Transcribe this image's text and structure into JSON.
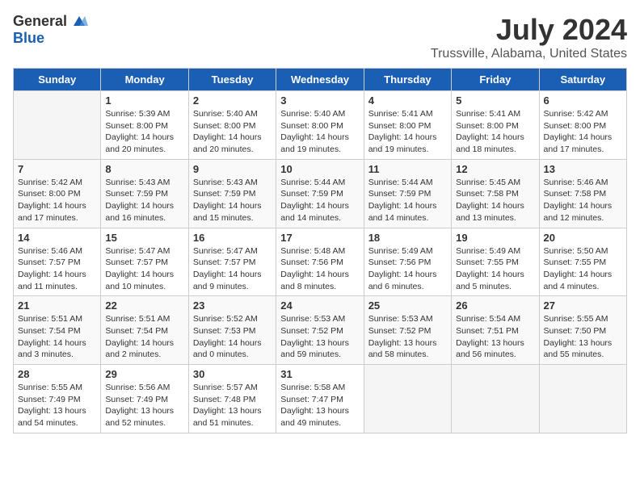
{
  "header": {
    "logo_general": "General",
    "logo_blue": "Blue",
    "title": "July 2024",
    "subtitle": "Trussville, Alabama, United States"
  },
  "columns": [
    "Sunday",
    "Monday",
    "Tuesday",
    "Wednesday",
    "Thursday",
    "Friday",
    "Saturday"
  ],
  "weeks": [
    [
      {
        "day": "",
        "empty": true
      },
      {
        "day": "1",
        "sunrise": "Sunrise: 5:39 AM",
        "sunset": "Sunset: 8:00 PM",
        "daylight": "Daylight: 14 hours and 20 minutes."
      },
      {
        "day": "2",
        "sunrise": "Sunrise: 5:40 AM",
        "sunset": "Sunset: 8:00 PM",
        "daylight": "Daylight: 14 hours and 20 minutes."
      },
      {
        "day": "3",
        "sunrise": "Sunrise: 5:40 AM",
        "sunset": "Sunset: 8:00 PM",
        "daylight": "Daylight: 14 hours and 19 minutes."
      },
      {
        "day": "4",
        "sunrise": "Sunrise: 5:41 AM",
        "sunset": "Sunset: 8:00 PM",
        "daylight": "Daylight: 14 hours and 19 minutes."
      },
      {
        "day": "5",
        "sunrise": "Sunrise: 5:41 AM",
        "sunset": "Sunset: 8:00 PM",
        "daylight": "Daylight: 14 hours and 18 minutes."
      },
      {
        "day": "6",
        "sunrise": "Sunrise: 5:42 AM",
        "sunset": "Sunset: 8:00 PM",
        "daylight": "Daylight: 14 hours and 17 minutes."
      }
    ],
    [
      {
        "day": "7",
        "sunrise": "Sunrise: 5:42 AM",
        "sunset": "Sunset: 8:00 PM",
        "daylight": "Daylight: 14 hours and 17 minutes."
      },
      {
        "day": "8",
        "sunrise": "Sunrise: 5:43 AM",
        "sunset": "Sunset: 7:59 PM",
        "daylight": "Daylight: 14 hours and 16 minutes."
      },
      {
        "day": "9",
        "sunrise": "Sunrise: 5:43 AM",
        "sunset": "Sunset: 7:59 PM",
        "daylight": "Daylight: 14 hours and 15 minutes."
      },
      {
        "day": "10",
        "sunrise": "Sunrise: 5:44 AM",
        "sunset": "Sunset: 7:59 PM",
        "daylight": "Daylight: 14 hours and 14 minutes."
      },
      {
        "day": "11",
        "sunrise": "Sunrise: 5:44 AM",
        "sunset": "Sunset: 7:59 PM",
        "daylight": "Daylight: 14 hours and 14 minutes."
      },
      {
        "day": "12",
        "sunrise": "Sunrise: 5:45 AM",
        "sunset": "Sunset: 7:58 PM",
        "daylight": "Daylight: 14 hours and 13 minutes."
      },
      {
        "day": "13",
        "sunrise": "Sunrise: 5:46 AM",
        "sunset": "Sunset: 7:58 PM",
        "daylight": "Daylight: 14 hours and 12 minutes."
      }
    ],
    [
      {
        "day": "14",
        "sunrise": "Sunrise: 5:46 AM",
        "sunset": "Sunset: 7:57 PM",
        "daylight": "Daylight: 14 hours and 11 minutes."
      },
      {
        "day": "15",
        "sunrise": "Sunrise: 5:47 AM",
        "sunset": "Sunset: 7:57 PM",
        "daylight": "Daylight: 14 hours and 10 minutes."
      },
      {
        "day": "16",
        "sunrise": "Sunrise: 5:47 AM",
        "sunset": "Sunset: 7:57 PM",
        "daylight": "Daylight: 14 hours and 9 minutes."
      },
      {
        "day": "17",
        "sunrise": "Sunrise: 5:48 AM",
        "sunset": "Sunset: 7:56 PM",
        "daylight": "Daylight: 14 hours and 8 minutes."
      },
      {
        "day": "18",
        "sunrise": "Sunrise: 5:49 AM",
        "sunset": "Sunset: 7:56 PM",
        "daylight": "Daylight: 14 hours and 6 minutes."
      },
      {
        "day": "19",
        "sunrise": "Sunrise: 5:49 AM",
        "sunset": "Sunset: 7:55 PM",
        "daylight": "Daylight: 14 hours and 5 minutes."
      },
      {
        "day": "20",
        "sunrise": "Sunrise: 5:50 AM",
        "sunset": "Sunset: 7:55 PM",
        "daylight": "Daylight: 14 hours and 4 minutes."
      }
    ],
    [
      {
        "day": "21",
        "sunrise": "Sunrise: 5:51 AM",
        "sunset": "Sunset: 7:54 PM",
        "daylight": "Daylight: 14 hours and 3 minutes."
      },
      {
        "day": "22",
        "sunrise": "Sunrise: 5:51 AM",
        "sunset": "Sunset: 7:54 PM",
        "daylight": "Daylight: 14 hours and 2 minutes."
      },
      {
        "day": "23",
        "sunrise": "Sunrise: 5:52 AM",
        "sunset": "Sunset: 7:53 PM",
        "daylight": "Daylight: 14 hours and 0 minutes."
      },
      {
        "day": "24",
        "sunrise": "Sunrise: 5:53 AM",
        "sunset": "Sunset: 7:52 PM",
        "daylight": "Daylight: 13 hours and 59 minutes."
      },
      {
        "day": "25",
        "sunrise": "Sunrise: 5:53 AM",
        "sunset": "Sunset: 7:52 PM",
        "daylight": "Daylight: 13 hours and 58 minutes."
      },
      {
        "day": "26",
        "sunrise": "Sunrise: 5:54 AM",
        "sunset": "Sunset: 7:51 PM",
        "daylight": "Daylight: 13 hours and 56 minutes."
      },
      {
        "day": "27",
        "sunrise": "Sunrise: 5:55 AM",
        "sunset": "Sunset: 7:50 PM",
        "daylight": "Daylight: 13 hours and 55 minutes."
      }
    ],
    [
      {
        "day": "28",
        "sunrise": "Sunrise: 5:55 AM",
        "sunset": "Sunset: 7:49 PM",
        "daylight": "Daylight: 13 hours and 54 minutes."
      },
      {
        "day": "29",
        "sunrise": "Sunrise: 5:56 AM",
        "sunset": "Sunset: 7:49 PM",
        "daylight": "Daylight: 13 hours and 52 minutes."
      },
      {
        "day": "30",
        "sunrise": "Sunrise: 5:57 AM",
        "sunset": "Sunset: 7:48 PM",
        "daylight": "Daylight: 13 hours and 51 minutes."
      },
      {
        "day": "31",
        "sunrise": "Sunrise: 5:58 AM",
        "sunset": "Sunset: 7:47 PM",
        "daylight": "Daylight: 13 hours and 49 minutes."
      },
      {
        "day": "",
        "empty": true
      },
      {
        "day": "",
        "empty": true
      },
      {
        "day": "",
        "empty": true
      }
    ]
  ]
}
